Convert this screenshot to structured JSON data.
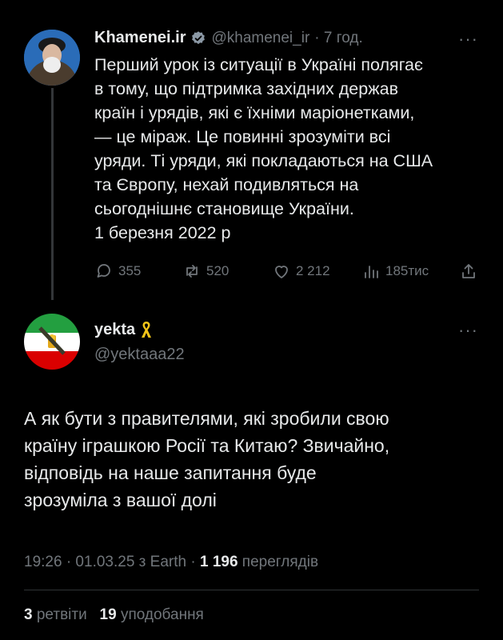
{
  "parent_tweet": {
    "display_name": "Khamenei.ir",
    "handle": "@khamenei_ir",
    "time": "· 7 год.",
    "text_lines": [
      "Перший урок із ситуації в Україні полягає",
      "в тому, що підтримка західних держав",
      "країн і урядів, які є їхніми маріонетками,",
      "— це міраж. Це повинні зрозуміти всі",
      "уряди. Ті уряди, які покладаються на США",
      "та Європу, нехай подивляться на",
      "сьогоднішнє становище України.",
      "1 березня 2022 р"
    ],
    "actions": {
      "replies": "355",
      "reposts": "520",
      "likes": "2 212",
      "views": "185тис"
    },
    "verified_color": "#8b98a5"
  },
  "reply_tweet": {
    "display_name": "yekta",
    "handle": "@yektaaa22",
    "badge_icon": "yellow-ribbon-icon",
    "text_lines": [
      "А як бути з правителями, які зробили свою",
      "країну іграшкою Росії та Китаю?  Звичайно,",
      "відповідь на наше запитання буде",
      "зрозуміла з вашої долі"
    ],
    "meta": {
      "time_date": "19:26 · 01.03.25 з Earth ·",
      "views_count": "1 196",
      "views_label": "переглядів"
    },
    "stats": {
      "retweets_count": "3",
      "retweets_label": "ретвіти",
      "likes_count": "19",
      "likes_label": "уподобання"
    }
  },
  "colors": {
    "background": "#000000",
    "text": "#e7e9ea",
    "muted": "#71767b",
    "ribbon": "#f5c518"
  }
}
